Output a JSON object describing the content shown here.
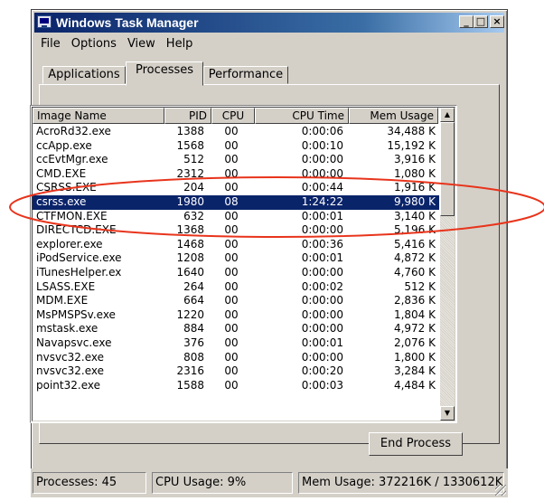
{
  "window": {
    "title": "Windows Task Manager"
  },
  "menu": [
    "File",
    "Options",
    "View",
    "Help"
  ],
  "tabs": [
    "Applications",
    "Processes",
    "Performance"
  ],
  "columns": [
    "Image Name",
    "PID",
    "CPU",
    "CPU Time",
    "Mem Usage"
  ],
  "processes": [
    {
      "name": "AcroRd32.exe",
      "pid": "1388",
      "cpu": "00",
      "time": "0:00:06",
      "mem": "34,488 K"
    },
    {
      "name": "ccApp.exe",
      "pid": "1568",
      "cpu": "00",
      "time": "0:00:10",
      "mem": "15,192 K"
    },
    {
      "name": "ccEvtMgr.exe",
      "pid": "512",
      "cpu": "00",
      "time": "0:00:00",
      "mem": "3,916 K"
    },
    {
      "name": "CMD.EXE",
      "pid": "2312",
      "cpu": "00",
      "time": "0:00:00",
      "mem": "1,080 K"
    },
    {
      "name": "CSRSS.EXE",
      "pid": "204",
      "cpu": "00",
      "time": "0:00:44",
      "mem": "1,916 K"
    },
    {
      "name": "csrss.exe",
      "pid": "1980",
      "cpu": "08",
      "time": "1:24:22",
      "mem": "9,980 K"
    },
    {
      "name": "CTFMON.EXE",
      "pid": "632",
      "cpu": "00",
      "time": "0:00:01",
      "mem": "3,140 K"
    },
    {
      "name": "DIRECTCD.EXE",
      "pid": "1368",
      "cpu": "00",
      "time": "0:00:00",
      "mem": "5,196 K"
    },
    {
      "name": "explorer.exe",
      "pid": "1468",
      "cpu": "00",
      "time": "0:00:36",
      "mem": "5,416 K"
    },
    {
      "name": "iPodService.exe",
      "pid": "1208",
      "cpu": "00",
      "time": "0:00:01",
      "mem": "4,872 K"
    },
    {
      "name": "iTunesHelper.ex",
      "pid": "1640",
      "cpu": "00",
      "time": "0:00:00",
      "mem": "4,760 K"
    },
    {
      "name": "LSASS.EXE",
      "pid": "264",
      "cpu": "00",
      "time": "0:00:02",
      "mem": "512 K"
    },
    {
      "name": "MDM.EXE",
      "pid": "664",
      "cpu": "00",
      "time": "0:00:00",
      "mem": "2,836 K"
    },
    {
      "name": "MsPMSPSv.exe",
      "pid": "1220",
      "cpu": "00",
      "time": "0:00:00",
      "mem": "1,804 K"
    },
    {
      "name": "mstask.exe",
      "pid": "884",
      "cpu": "00",
      "time": "0:00:00",
      "mem": "4,972 K"
    },
    {
      "name": "Navapsvc.exe",
      "pid": "376",
      "cpu": "00",
      "time": "0:00:01",
      "mem": "2,076 K"
    },
    {
      "name": "nvsvc32.exe",
      "pid": "808",
      "cpu": "00",
      "time": "0:00:00",
      "mem": "1,800 K"
    },
    {
      "name": "nvsvc32.exe",
      "pid": "2316",
      "cpu": "00",
      "time": "0:00:20",
      "mem": "3,284 K"
    },
    {
      "name": "point32.exe",
      "pid": "1588",
      "cpu": "00",
      "time": "0:00:03",
      "mem": "4,484 K"
    }
  ],
  "selected_process": "csrss.exe",
  "end_process_label": "End Process",
  "status": {
    "processes": "Processes: 45",
    "cpu": "CPU Usage: 9%",
    "mem": "Mem Usage: 372216K / 1330612K"
  },
  "colors": {
    "selection": "#0a246a",
    "annotation": "#e8341c"
  }
}
